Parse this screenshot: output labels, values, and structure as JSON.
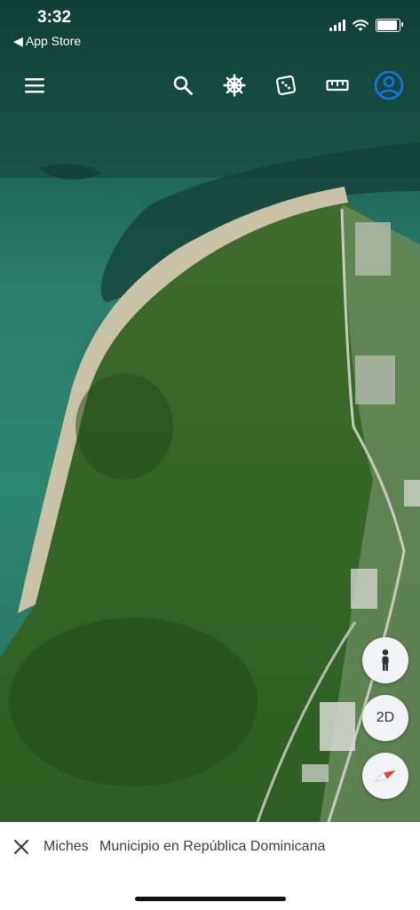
{
  "status_bar": {
    "time": "3:32",
    "back_label": "◀ App Store",
    "signal_bars": 4,
    "battery_level": 0.9
  },
  "toolbar": {
    "menu_icon": "hamburger-menu-icon",
    "search_icon": "search-icon",
    "voyager_icon": "ship-wheel-icon",
    "feeling_lucky_icon": "dice-icon",
    "measure_icon": "ruler-icon",
    "account_icon": "account-circle-icon",
    "accent_color": "#1a73e8"
  },
  "map_controls": {
    "pegman_icon": "person-icon",
    "view_mode_label": "2D",
    "compass_icon": "compass-icon"
  },
  "place_card": {
    "name": "Miches",
    "description": "Municipio en República Dominicana",
    "close_icon": "close-icon"
  }
}
